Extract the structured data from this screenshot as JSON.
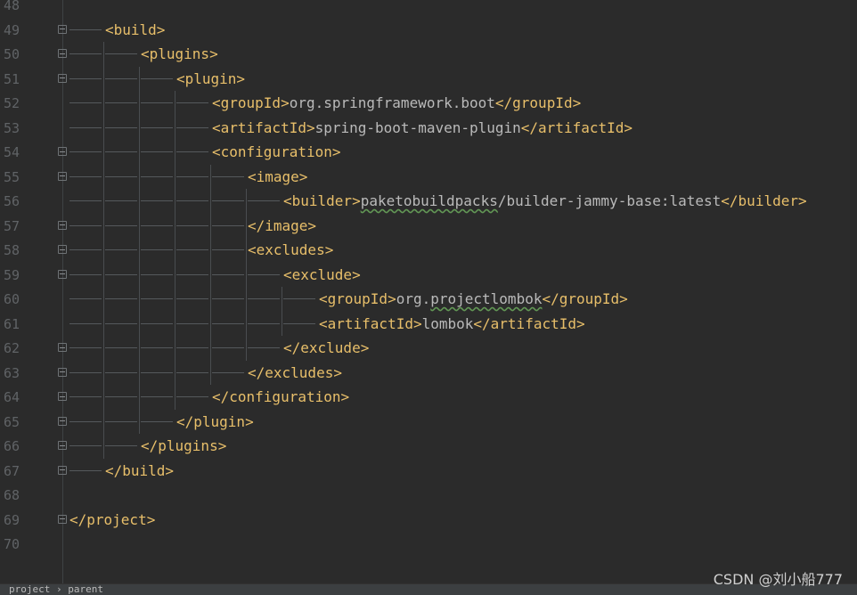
{
  "editor": {
    "lines": [
      {
        "num": "48",
        "depth": 0,
        "fold": "none",
        "parts": []
      },
      {
        "num": "49",
        "depth": 1,
        "fold": "open",
        "parts": [
          {
            "cls": "tag",
            "t": "<build>"
          }
        ]
      },
      {
        "num": "50",
        "depth": 2,
        "fold": "open",
        "parts": [
          {
            "cls": "tag",
            "t": "<plugins>"
          }
        ]
      },
      {
        "num": "51",
        "depth": 3,
        "fold": "open",
        "parts": [
          {
            "cls": "tag",
            "t": "<plugin>"
          }
        ]
      },
      {
        "num": "52",
        "depth": 4,
        "fold": "none",
        "parts": [
          {
            "cls": "tag",
            "t": "<groupId>"
          },
          {
            "cls": "txt",
            "t": "org.springframework.boot"
          },
          {
            "cls": "tag",
            "t": "</groupId>"
          }
        ]
      },
      {
        "num": "53",
        "depth": 4,
        "fold": "none",
        "parts": [
          {
            "cls": "tag",
            "t": "<artifactId>"
          },
          {
            "cls": "txt",
            "t": "spring-boot-maven-plugin"
          },
          {
            "cls": "tag",
            "t": "</artifactId>"
          }
        ]
      },
      {
        "num": "54",
        "depth": 4,
        "fold": "open",
        "parts": [
          {
            "cls": "tag",
            "t": "<configuration>"
          }
        ]
      },
      {
        "num": "55",
        "depth": 5,
        "fold": "open",
        "parts": [
          {
            "cls": "tag",
            "t": "<image>"
          }
        ]
      },
      {
        "num": "56",
        "depth": 6,
        "fold": "none",
        "parts": [
          {
            "cls": "tag",
            "t": "<builder>"
          },
          {
            "cls": "txt typo",
            "t": "paketobuildpacks"
          },
          {
            "cls": "txt",
            "t": "/builder-jammy-base:latest"
          },
          {
            "cls": "tag",
            "t": "</builder>"
          }
        ]
      },
      {
        "num": "57",
        "depth": 5,
        "fold": "close",
        "parts": [
          {
            "cls": "tag",
            "t": "</image>"
          }
        ]
      },
      {
        "num": "58",
        "depth": 5,
        "fold": "open",
        "parts": [
          {
            "cls": "tag",
            "t": "<excludes>"
          }
        ]
      },
      {
        "num": "59",
        "depth": 6,
        "fold": "open",
        "parts": [
          {
            "cls": "tag",
            "t": "<exclude>"
          }
        ]
      },
      {
        "num": "60",
        "depth": 7,
        "fold": "none",
        "parts": [
          {
            "cls": "tag",
            "t": "<groupId>"
          },
          {
            "cls": "txt",
            "t": "org."
          },
          {
            "cls": "txt typo",
            "t": "projectlombok"
          },
          {
            "cls": "tag",
            "t": "</groupId>"
          }
        ]
      },
      {
        "num": "61",
        "depth": 7,
        "fold": "none",
        "parts": [
          {
            "cls": "tag",
            "t": "<artifactId>"
          },
          {
            "cls": "txt",
            "t": "lombok"
          },
          {
            "cls": "tag",
            "t": "</artifactId>"
          }
        ]
      },
      {
        "num": "62",
        "depth": 6,
        "fold": "close",
        "parts": [
          {
            "cls": "tag",
            "t": "</exclude>"
          }
        ]
      },
      {
        "num": "63",
        "depth": 5,
        "fold": "close",
        "parts": [
          {
            "cls": "tag",
            "t": "</excludes>"
          }
        ]
      },
      {
        "num": "64",
        "depth": 4,
        "fold": "close",
        "parts": [
          {
            "cls": "tag",
            "t": "</configuration>"
          }
        ]
      },
      {
        "num": "65",
        "depth": 3,
        "fold": "close",
        "parts": [
          {
            "cls": "tag",
            "t": "</plugin>"
          }
        ]
      },
      {
        "num": "66",
        "depth": 2,
        "fold": "close",
        "parts": [
          {
            "cls": "tag",
            "t": "</plugins>"
          }
        ]
      },
      {
        "num": "67",
        "depth": 1,
        "fold": "close",
        "parts": [
          {
            "cls": "tag",
            "t": "</build>"
          }
        ]
      },
      {
        "num": "68",
        "depth": 0,
        "fold": "none",
        "parts": []
      },
      {
        "num": "69",
        "depth": 0,
        "fold": "close",
        "parts": [
          {
            "cls": "tag",
            "t": "</project>"
          }
        ]
      },
      {
        "num": "70",
        "depth": 0,
        "fold": "none",
        "parts": []
      }
    ]
  },
  "breadcrumbs": "project  ›  parent",
  "watermark": "CSDN @刘小船777",
  "colors": {
    "background": "#2b2b2b",
    "tag": "#e8bf6a",
    "text": "#bababa",
    "line_number": "#606366",
    "typo_underline": "#629755"
  },
  "icons": {
    "fold_marker": "fold-toggle-icon"
  }
}
